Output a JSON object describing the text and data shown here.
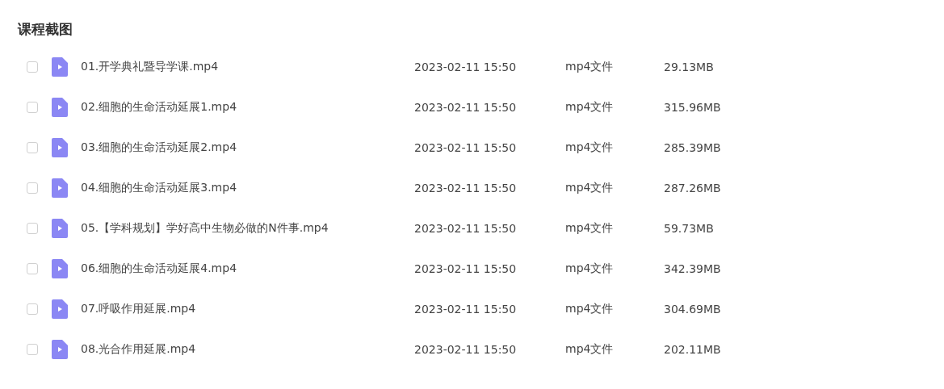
{
  "title": "课程截图",
  "files": [
    {
      "name": "01.开学典礼暨导学课.mp4",
      "date": "2023-02-11 15:50",
      "type": "mp4文件",
      "size": "29.13MB",
      "checked": false
    },
    {
      "name": "02.细胞的生命活动延展1.mp4",
      "date": "2023-02-11 15:50",
      "type": "mp4文件",
      "size": "315.96MB",
      "checked": false
    },
    {
      "name": "03.细胞的生命活动延展2.mp4",
      "date": "2023-02-11 15:50",
      "type": "mp4文件",
      "size": "285.39MB",
      "checked": false
    },
    {
      "name": "04.细胞的生命活动延展3.mp4",
      "date": "2023-02-11 15:50",
      "type": "mp4文件",
      "size": "287.26MB",
      "checked": false
    },
    {
      "name": "05.【学科规划】学好高中生物必做的N件事.mp4",
      "date": "2023-02-11 15:50",
      "type": "mp4文件",
      "size": "59.73MB",
      "checked": false
    },
    {
      "name": "06.细胞的生命活动延展4.mp4",
      "date": "2023-02-11 15:50",
      "type": "mp4文件",
      "size": "342.39MB",
      "checked": false
    },
    {
      "name": "07.呼吸作用延展.mp4",
      "date": "2023-02-11 15:50",
      "type": "mp4文件",
      "size": "304.69MB",
      "checked": false
    },
    {
      "name": "08.光合作用延展.mp4",
      "date": "2023-02-11 15:50",
      "type": "mp4文件",
      "size": "202.11MB",
      "checked": false
    }
  ]
}
